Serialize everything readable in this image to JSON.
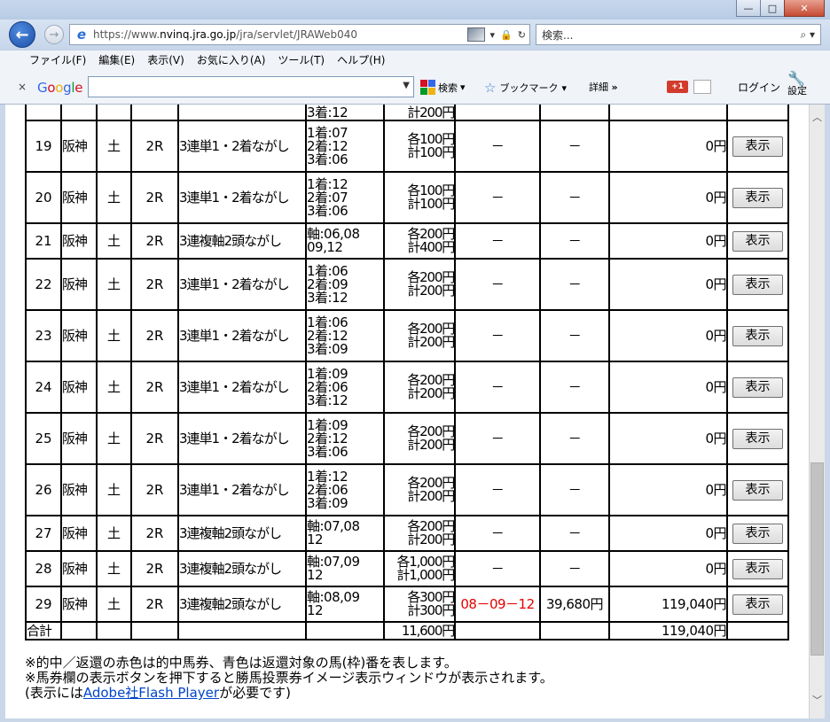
{
  "window": {
    "controls": [
      "—",
      "□",
      "✕"
    ]
  },
  "nav": {
    "url_prefix": "https://www.",
    "url_domain": "nvinq.jra.go.jp",
    "url_path": "/jra/servlet/JRAWeb040",
    "search_placeholder": "検索...",
    "search_icon": "magnifier-icon"
  },
  "menu": {
    "items": [
      "ファイル(F)",
      "編集(E)",
      "表示(V)",
      "お気に入り(A)",
      "ツール(T)",
      "ヘルプ(H)"
    ]
  },
  "toolbar": {
    "close": "×",
    "google": "Google",
    "search_label": "検索",
    "bookmark_label": "ブックマーク",
    "detail_label": "詳細",
    "detail_chevron": "»",
    "gplus": "+1",
    "login_label": "ログイン",
    "settings_label": "設定"
  },
  "table": {
    "partial_row": {
      "combo": [
        "3着:12"
      ],
      "amount": [
        "計200円"
      ]
    },
    "rows": [
      {
        "no": "19",
        "place": "阪神",
        "day": "土",
        "race": "2R",
        "type": "3連単1・2着ながし",
        "combo": [
          "1着:07",
          "2着:12",
          "3着:06"
        ],
        "amount": [
          "各100円",
          "計100円"
        ],
        "hit": "－",
        "payout": "－",
        "total": "0円",
        "button": "表示"
      },
      {
        "no": "20",
        "place": "阪神",
        "day": "土",
        "race": "2R",
        "type": "3連単1・2着ながし",
        "combo": [
          "1着:12",
          "2着:07",
          "3着:06"
        ],
        "amount": [
          "各100円",
          "計100円"
        ],
        "hit": "－",
        "payout": "－",
        "total": "0円",
        "button": "表示"
      },
      {
        "no": "21",
        "place": "阪神",
        "day": "土",
        "race": "2R",
        "type": "3連複軸2頭ながし",
        "combo": [
          "軸:06,08",
          "09,12"
        ],
        "amount": [
          "各200円",
          "計400円"
        ],
        "hit": "－",
        "payout": "－",
        "total": "0円",
        "button": "表示"
      },
      {
        "no": "22",
        "place": "阪神",
        "day": "土",
        "race": "2R",
        "type": "3連単1・2着ながし",
        "combo": [
          "1着:06",
          "2着:09",
          "3着:12"
        ],
        "amount": [
          "各200円",
          "計200円"
        ],
        "hit": "－",
        "payout": "－",
        "total": "0円",
        "button": "表示"
      },
      {
        "no": "23",
        "place": "阪神",
        "day": "土",
        "race": "2R",
        "type": "3連単1・2着ながし",
        "combo": [
          "1着:06",
          "2着:12",
          "3着:09"
        ],
        "amount": [
          "各200円",
          "計200円"
        ],
        "hit": "－",
        "payout": "－",
        "total": "0円",
        "button": "表示"
      },
      {
        "no": "24",
        "place": "阪神",
        "day": "土",
        "race": "2R",
        "type": "3連単1・2着ながし",
        "combo": [
          "1着:09",
          "2着:06",
          "3着:12"
        ],
        "amount": [
          "各200円",
          "計200円"
        ],
        "hit": "－",
        "payout": "－",
        "total": "0円",
        "button": "表示"
      },
      {
        "no": "25",
        "place": "阪神",
        "day": "土",
        "race": "2R",
        "type": "3連単1・2着ながし",
        "combo": [
          "1着:09",
          "2着:12",
          "3着:06"
        ],
        "amount": [
          "各200円",
          "計200円"
        ],
        "hit": "－",
        "payout": "－",
        "total": "0円",
        "button": "表示"
      },
      {
        "no": "26",
        "place": "阪神",
        "day": "土",
        "race": "2R",
        "type": "3連単1・2着ながし",
        "combo": [
          "1着:12",
          "2着:06",
          "3着:09"
        ],
        "amount": [
          "各200円",
          "計200円"
        ],
        "hit": "－",
        "payout": "－",
        "total": "0円",
        "button": "表示"
      },
      {
        "no": "27",
        "place": "阪神",
        "day": "土",
        "race": "2R",
        "type": "3連複軸2頭ながし",
        "combo": [
          "軸:07,08",
          "12"
        ],
        "amount": [
          "各200円",
          "計200円"
        ],
        "hit": "－",
        "payout": "－",
        "total": "0円",
        "button": "表示"
      },
      {
        "no": "28",
        "place": "阪神",
        "day": "土",
        "race": "2R",
        "type": "3連複軸2頭ながし",
        "combo": [
          "軸:07,09",
          "12"
        ],
        "amount": [
          "各1,000円",
          "計1,000円"
        ],
        "hit": "－",
        "payout": "－",
        "total": "0円",
        "button": "表示"
      },
      {
        "no": "29",
        "place": "阪神",
        "day": "土",
        "race": "2R",
        "type": "3連複軸2頭ながし",
        "combo": [
          "軸:08,09",
          "12"
        ],
        "amount": [
          "各300円",
          "計300円"
        ],
        "hit": "08－09－12",
        "hit_color": "#e60000",
        "payout": "39,680円",
        "total": "119,040円",
        "button": "表示"
      }
    ],
    "sum": {
      "label": "合計",
      "amount": "11,600円",
      "total": "119,040円"
    }
  },
  "notes": {
    "line1": "※的中／返還の赤色は的中馬券、青色は返還対象の馬(枠)番を表します。",
    "line2": "※馬券欄の表示ボタンを押下すると勝馬投票券イメージ表示ウィンドウが表示されます。",
    "line3_pre": "(表示には",
    "line3_link": "Adobe社Flash Player",
    "line3_post": "が必要です)"
  }
}
